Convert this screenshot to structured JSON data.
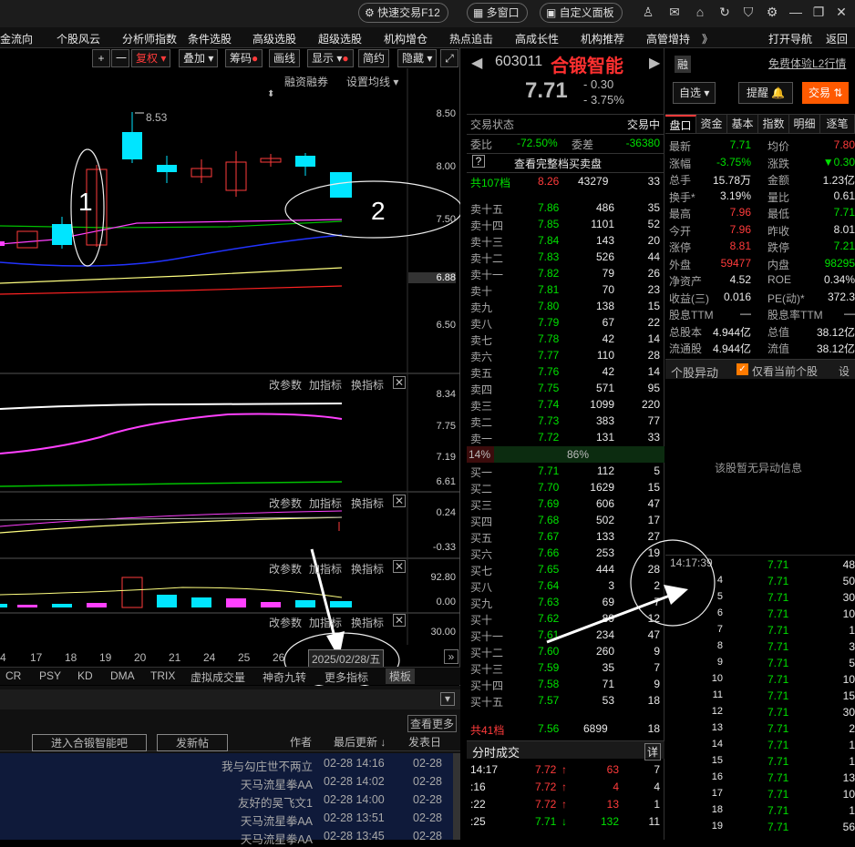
{
  "topbar": {
    "quick_trade": "快速交易F12",
    "multi_window": "多窗口",
    "custom_panel": "自定义面板"
  },
  "menu": [
    "金流向",
    "个股风云",
    "分析师指数",
    "条件选股",
    "高级选股",
    "超级选股",
    "机构增仓",
    "热点追击",
    "高成长性",
    "机构推荐",
    "高管增持",
    "》",
    "打开导航",
    "返回"
  ],
  "chart_toolbar": {
    "plus": "+",
    "minus": "一",
    "fuquan": "复权",
    "overlay": "叠加",
    "chips": "筹码",
    "draw": "画线",
    "display": "显示",
    "simple": "简约",
    "hide": "隐藏"
  },
  "chart_top": {
    "margin": "融资融券",
    "ma_settings": "设置均线"
  },
  "price_axis": [
    "8.50",
    "8.00",
    "7.50",
    "6.88",
    "6.50"
  ],
  "high_label": "8.53",
  "annotations": {
    "n1": "1",
    "n2": "2"
  },
  "indicator_panels": [
    {
      "labels": [
        "改参数",
        "加指标",
        "换指标"
      ],
      "axis": [
        "8.34",
        "7.75",
        "7.19",
        "6.61"
      ]
    },
    {
      "labels": [
        "改参数",
        "加指标",
        "换指标"
      ],
      "axis": [
        "0.24",
        "-0.33"
      ]
    },
    {
      "labels": [
        "改参数",
        "加指标",
        "换指标"
      ],
      "axis": [
        "92.80",
        "0.00"
      ]
    },
    {
      "labels": [
        "改参数",
        "加指标",
        "换指标"
      ],
      "axis": [
        "30.00"
      ]
    }
  ],
  "x_axis": [
    "4",
    "17",
    "18",
    "19",
    "20",
    "21",
    "24",
    "25",
    "26"
  ],
  "date_cursor": "2025/02/28/五",
  "indicator_tabs": [
    "CR",
    "PSY",
    "KD",
    "DMA",
    "TRIX",
    "虚拟成交量",
    "神奇九转",
    "更多指标",
    "模板"
  ],
  "forum": {
    "view_more": "查看更多",
    "enter_bar": "进入合锻智能吧",
    "post": "发新帖",
    "author": "作者",
    "last_update": "最后更新",
    "post_date": "发表日",
    "posts": [
      {
        "author": "我与勾庄世不两立",
        "time": "02-28 14:16",
        "date": "02-28"
      },
      {
        "author": "天马流星拳AA",
        "time": "02-28 14:02",
        "date": "02-28"
      },
      {
        "author": "友好的吴飞文1",
        "time": "02-28 14:00",
        "date": "02-28"
      },
      {
        "author": "天马流星拳AA",
        "time": "02-28 13:51",
        "date": "02-28"
      },
      {
        "author": "天马流星拳AA",
        "time": "02-28 13:45",
        "date": "02-28"
      }
    ]
  },
  "stock": {
    "code": "603011",
    "name": "合锻智能",
    "price": "7.71",
    "change": "- 0.30",
    "pct": "- 3.75%",
    "rong": "融",
    "free_l2": "免费体验L2行情",
    "watch": "自选",
    "alert": "提醒",
    "trade": "交易"
  },
  "trade_status": {
    "label": "交易状态",
    "value": "交易中"
  },
  "weibi": {
    "label": "委比",
    "value": "-72.50%",
    "wc_label": "委差",
    "wc_value": "-36380"
  },
  "view_full": "查看完整档买卖盘",
  "sell_total": {
    "label": "共107档",
    "price": "8.26",
    "vol": "43279",
    "n": "33"
  },
  "sells": [
    {
      "l": "卖十五",
      "p": "7.86",
      "v": "486",
      "n": "35"
    },
    {
      "l": "卖十四",
      "p": "7.85",
      "v": "1101",
      "n": "52"
    },
    {
      "l": "卖十三",
      "p": "7.84",
      "v": "143",
      "n": "20"
    },
    {
      "l": "卖十二",
      "p": "7.83",
      "v": "526",
      "n": "44"
    },
    {
      "l": "卖十一",
      "p": "7.82",
      "v": "79",
      "n": "26"
    },
    {
      "l": "卖十",
      "p": "7.81",
      "v": "70",
      "n": "23"
    },
    {
      "l": "卖九",
      "p": "7.80",
      "v": "138",
      "n": "15"
    },
    {
      "l": "卖八",
      "p": "7.79",
      "v": "67",
      "n": "22"
    },
    {
      "l": "卖七",
      "p": "7.78",
      "v": "42",
      "n": "14"
    },
    {
      "l": "卖六",
      "p": "7.77",
      "v": "110",
      "n": "28"
    },
    {
      "l": "卖五",
      "p": "7.76",
      "v": "42",
      "n": "14"
    },
    {
      "l": "卖四",
      "p": "7.75",
      "v": "571",
      "n": "95"
    },
    {
      "l": "卖三",
      "p": "7.74",
      "v": "1099",
      "n": "220"
    },
    {
      "l": "卖二",
      "p": "7.73",
      "v": "383",
      "n": "77"
    },
    {
      "l": "卖一",
      "p": "7.72",
      "v": "131",
      "n": "33"
    }
  ],
  "ratio": {
    "left": "14%",
    "right": "86%",
    "buy_share": 0.14
  },
  "buys": [
    {
      "l": "买一",
      "p": "7.71",
      "v": "112",
      "n": "5"
    },
    {
      "l": "买二",
      "p": "7.70",
      "v": "1629",
      "n": "15"
    },
    {
      "l": "买三",
      "p": "7.69",
      "v": "606",
      "n": "47"
    },
    {
      "l": "买四",
      "p": "7.68",
      "v": "502",
      "n": "17"
    },
    {
      "l": "买五",
      "p": "7.67",
      "v": "133",
      "n": "27"
    },
    {
      "l": "买六",
      "p": "7.66",
      "v": "253",
      "n": "19"
    },
    {
      "l": "买七",
      "p": "7.65",
      "v": "444",
      "n": "28"
    },
    {
      "l": "买八",
      "p": "7.64",
      "v": "3",
      "n": "2"
    },
    {
      "l": "买九",
      "p": "7.63",
      "v": "69",
      "n": "7"
    },
    {
      "l": "买十",
      "p": "7.62",
      "v": "89",
      "n": "12"
    },
    {
      "l": "买十一",
      "p": "7.61",
      "v": "234",
      "n": "47"
    },
    {
      "l": "买十二",
      "p": "7.60",
      "v": "260",
      "n": "9"
    },
    {
      "l": "买十三",
      "p": "7.59",
      "v": "35",
      "n": "7"
    },
    {
      "l": "买十四",
      "p": "7.58",
      "v": "71",
      "n": "9"
    },
    {
      "l": "买十五",
      "p": "7.57",
      "v": "53",
      "n": "18"
    }
  ],
  "buy_total": {
    "label": "共41档",
    "price": "7.56",
    "vol": "6899",
    "n": "18"
  },
  "tick_title": "分时成交",
  "tick_detail": "详",
  "ticks": [
    {
      "t": "14:17",
      "p": "7.72",
      "v": "63",
      "n": "7",
      "c": "red"
    },
    {
      "t": ":16",
      "p": "7.72",
      "v": "4",
      "n": "4",
      "c": "red"
    },
    {
      "t": ":22",
      "p": "7.72",
      "v": "13",
      "n": "1",
      "c": "red"
    },
    {
      "t": ":25",
      "p": "7.71",
      "v": "132",
      "n": "11",
      "c": "grn"
    }
  ],
  "tabs": [
    "盘口",
    "资金",
    "基本",
    "指数",
    "明细",
    "逐笔"
  ],
  "quote": [
    {
      "l1": "最新",
      "v1": "7.71",
      "l2": "均价",
      "v2": "7.80"
    },
    {
      "l1": "涨幅",
      "v1": "-3.75%",
      "l2": "涨跌",
      "v2": "▼0.30"
    },
    {
      "l1": "总手",
      "v1": "15.78万",
      "l2": "金额",
      "v2": "1.23亿"
    },
    {
      "l1": "换手*",
      "v1": "3.19%",
      "l2": "量比",
      "v2": "0.61"
    },
    {
      "l1": "最高",
      "v1": "7.96",
      "l2": "最低",
      "v2": "7.71"
    },
    {
      "l1": "今开",
      "v1": "7.96",
      "l2": "昨收",
      "v2": "8.01"
    },
    {
      "l1": "涨停",
      "v1": "8.81",
      "l2": "跌停",
      "v2": "7.21"
    },
    {
      "l1": "外盘",
      "v1": "59477",
      "l2": "内盘",
      "v2": "98295"
    },
    {
      "l1": "净资产",
      "v1": "4.52",
      "l2": "ROE",
      "v2": "0.34%"
    },
    {
      "l1": "收益(三)",
      "v1": "0.016",
      "l2": "PE(动)*",
      "v2": "372.3"
    },
    {
      "l1": "股息TTM",
      "v1": "—",
      "l2": "股息率TTM",
      "v2": "—"
    },
    {
      "l1": "总股本",
      "v1": "4.944亿",
      "l2": "总值",
      "v2": "38.12亿"
    },
    {
      "l1": "流通股",
      "v1": "4.944亿",
      "l2": "流值",
      "v2": "38.12亿"
    }
  ],
  "anomaly": {
    "title": "个股异动",
    "check": "仅看当前个股",
    "set": "设",
    "empty": "该股暂无异动信息"
  },
  "fills_time": "14:17:39",
  "fills": [
    {
      "t": "",
      "p": "7.71",
      "v": "48"
    },
    {
      "t": "4",
      "p": "7.71",
      "v": "50"
    },
    {
      "t": "5",
      "p": "7.71",
      "v": "30"
    },
    {
      "t": "6",
      "p": "7.71",
      "v": "10"
    },
    {
      "t": "7",
      "p": "7.71",
      "v": "1"
    },
    {
      "t": "8",
      "p": "7.71",
      "v": "3"
    },
    {
      "t": "9",
      "p": "7.71",
      "v": "5"
    },
    {
      "t": "10",
      "p": "7.71",
      "v": "10"
    },
    {
      "t": "11",
      "p": "7.71",
      "v": "15"
    },
    {
      "t": "12",
      "p": "7.71",
      "v": "30"
    },
    {
      "t": "13",
      "p": "7.71",
      "v": "2"
    },
    {
      "t": "14",
      "p": "7.71",
      "v": "1"
    },
    {
      "t": "15",
      "p": "7.71",
      "v": "1"
    },
    {
      "t": "16",
      "p": "7.71",
      "v": "13"
    },
    {
      "t": "17",
      "p": "7.71",
      "v": "10"
    },
    {
      "t": "18",
      "p": "7.71",
      "v": "1"
    },
    {
      "t": "19",
      "p": "7.71",
      "v": "56"
    }
  ],
  "colors": {
    "up": "#ff3b3b",
    "down": "#00e000",
    "cyan": "#00e5ff",
    "bg": "#000000"
  }
}
